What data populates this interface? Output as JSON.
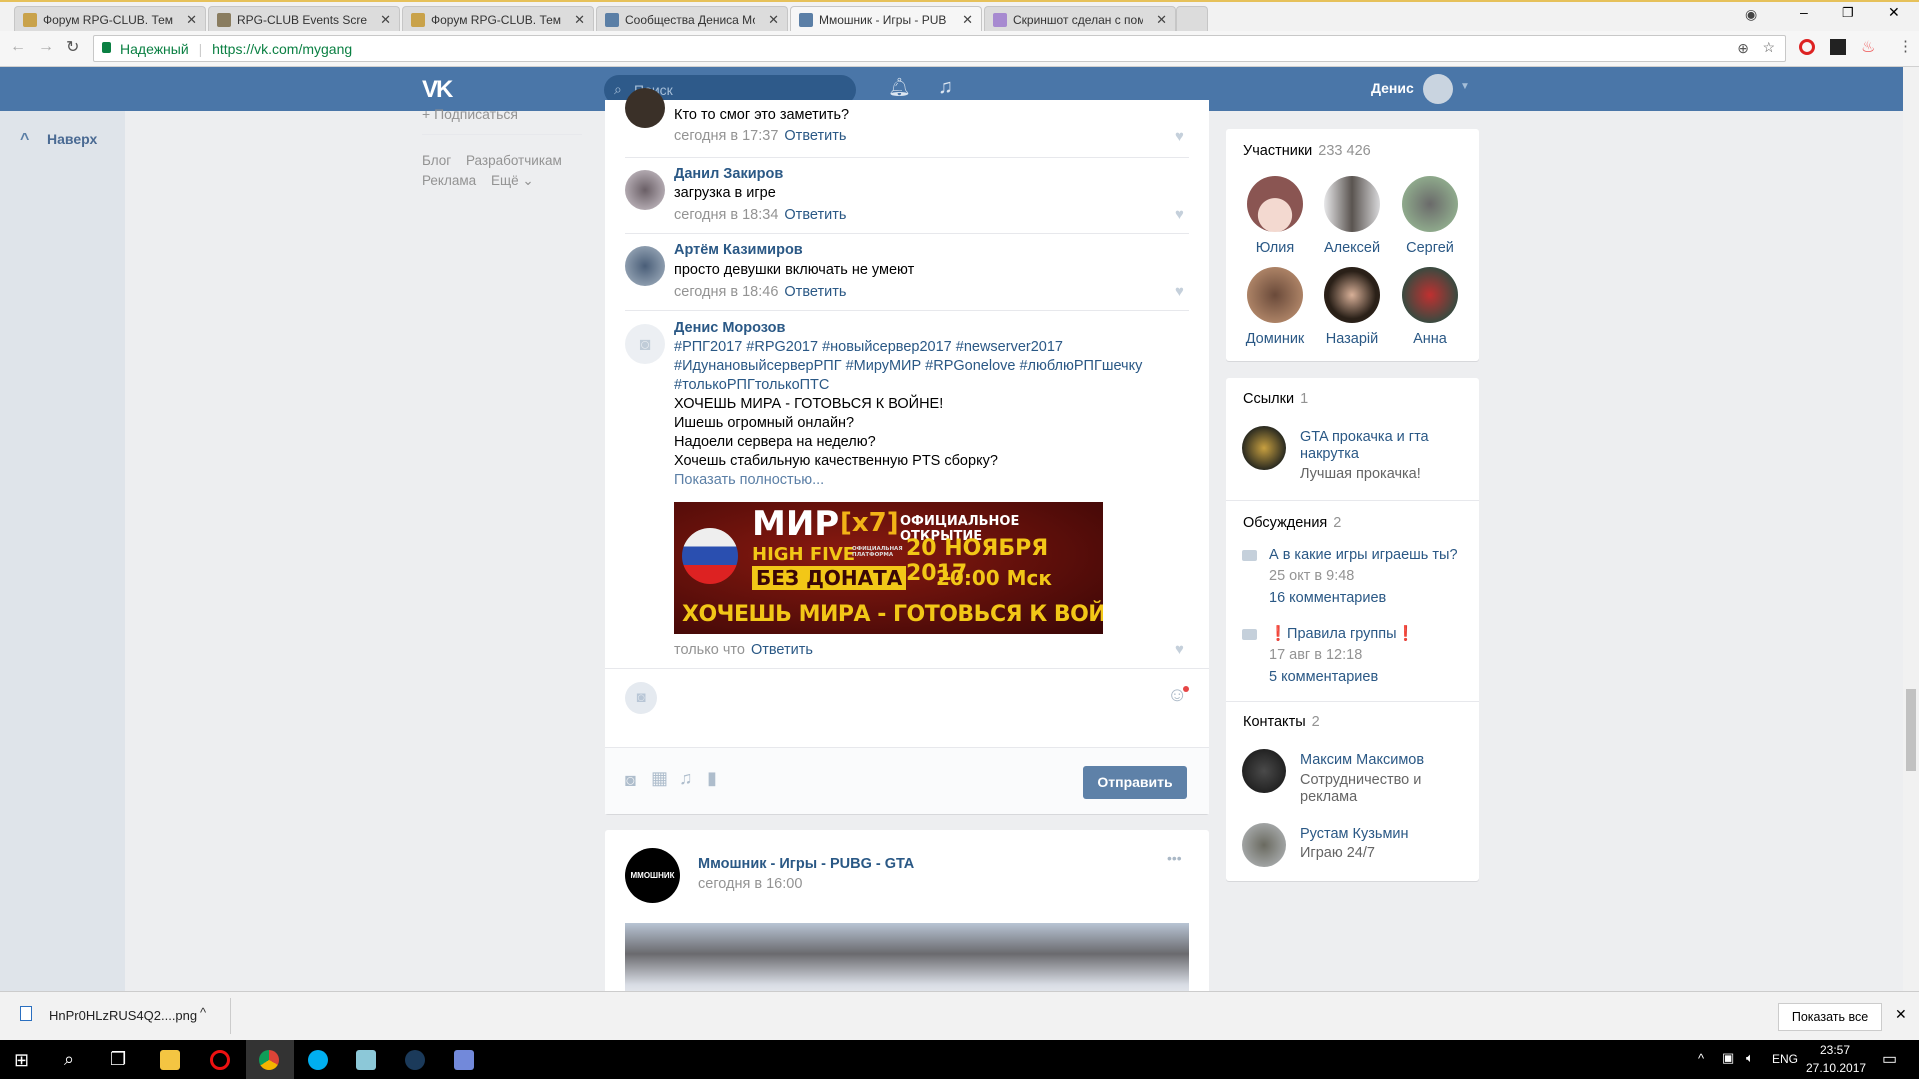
{
  "browser": {
    "tabs": [
      {
        "title": "Форум RPG-CLUB. Тема"
      },
      {
        "title": "RPG-CLUB Events Screen"
      },
      {
        "title": "Форум RPG-CLUB. Тема"
      },
      {
        "title": "Сообщества Дениса Мо"
      },
      {
        "title": "Ммошник - Игры - PUB"
      },
      {
        "title": "Скриншот сделан с пом"
      }
    ],
    "secure_label": "Надежный",
    "url": "https://vk.com/mygang",
    "close_glyph": "✕"
  },
  "vk": {
    "logo": "VK",
    "search_placeholder": "Поиск",
    "user_name": "Денис"
  },
  "left": {
    "to_top": "Наверх",
    "subscribe": "+ Подписаться",
    "footer": [
      "Блог",
      "Разработчикам",
      "Реклама",
      "Ещё ⌄"
    ]
  },
  "comments": [
    {
      "name": "",
      "text": "Кто то смог это заметить?",
      "time": "сегодня в 17:37",
      "reply": "Ответить"
    },
    {
      "name": "Данил Закиров",
      "text": "загрузка в игре",
      "time": "сегодня в 18:34",
      "reply": "Ответить"
    },
    {
      "name": "Артём Казимиров",
      "text": "просто девушки включать не умеют",
      "time": "сегодня в 18:46",
      "reply": "Ответить"
    },
    {
      "name": "Денис Морозов",
      "lines": [
        "#РПГ2017 #RPG2017 #новыйсервер2017 #newserver2017",
        "#ИдунановыйсерверРПГ #МируМИР #RPGonelove #люблюРПГшечку",
        "#толькоРПГтолькоПТС"
      ],
      "body": [
        "ХОЧЕШЬ МИРА - ГОТОВЬСЯ К ВОЙНЕ!",
        "Ишешь огромный онлайн?",
        "Надоели сервера на неделю?",
        "Хочешь стабильную качественную PTS сборку?"
      ],
      "more": "Показать полностью...",
      "time": "только что",
      "reply": "Ответить",
      "banner": {
        "t1": "МИР",
        "t2": "[x7]",
        "t3": "HIGH FIVE",
        "t4": "ОФИЦИАЛЬНАЯ ПЛАТФОРМА",
        "t5": "БЕЗ ДОНАТА",
        "t6": "ОФИЦИАЛЬНОЕ ОТКРЫТИЕ",
        "t7": "20 НОЯБРЯ 2017",
        "t8": "20:00 Мск",
        "t9": "ХОЧЕШЬ МИРА - ГОТОВЬСЯ К ВОЙНЕ"
      }
    }
  ],
  "composer": {
    "send": "Отправить"
  },
  "post": {
    "author": "Ммошник - Игры - PUBG - GTA",
    "time": "сегодня в 16:00",
    "more": "•••",
    "logo_text": "ММОШНИК"
  },
  "right": {
    "members": {
      "title": "Участники",
      "count": "233 426",
      "items": [
        "Юлия",
        "Алексей",
        "Сергей",
        "Доминик",
        "Назарій",
        "Анна"
      ]
    },
    "links": {
      "title": "Ссылки",
      "count": "1",
      "item": {
        "title1": "GTA прокачка и гта",
        "title2": "накрутка",
        "desc": "Лучшая прокачка!"
      }
    },
    "discussions": {
      "title": "Обсуждения",
      "count": "2",
      "items": [
        {
          "title": "А в какие игры играешь ты?",
          "date": "25 окт в 9:48",
          "comments": "16 комментариев"
        },
        {
          "title": "❗Правила группы❗",
          "date": "17 авг в 12:18",
          "comments": "5 комментариев"
        }
      ]
    },
    "contacts": {
      "title": "Контакты",
      "count": "2",
      "items": [
        {
          "name": "Максим Максимов",
          "d1": "Сотрудничество и",
          "d2": "реклама"
        },
        {
          "name": "Рустам Кузьмин",
          "d1": "Играю 24/7",
          "d2": ""
        }
      ]
    }
  },
  "download": {
    "file": "HnPr0HLzRUS4Q2....png",
    "show_all": "Показать все"
  },
  "taskbar": {
    "lang": "ENG",
    "time": "23:57",
    "date": "27.10.2017"
  },
  "colors": {
    "vk_blue": "#4a76a8",
    "link": "#2a5885",
    "bg": "#edeef0"
  }
}
